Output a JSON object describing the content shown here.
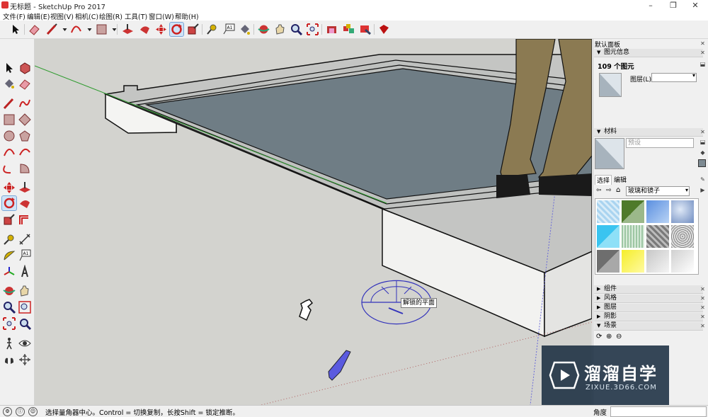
{
  "window": {
    "title": "无标题 - SketchUp Pro 2017",
    "minimize": "–",
    "maximize": "❐",
    "close": "✕"
  },
  "menu": [
    "文件(F)",
    "编辑(E)",
    "视图(V)",
    "相机(C)",
    "绘图(R)",
    "工具(T)",
    "窗口(W)",
    "帮助(H)"
  ],
  "toolbar": {
    "active_tool": "rotate-tool"
  },
  "viewport": {
    "tooltip": "解锁的平面",
    "colors": {
      "ground": "#d3d3cf",
      "glass": "#6f7d85",
      "slab_top": "#c4c5c3",
      "axis_green": "#2e9b2e",
      "protractor": "#3333bb"
    }
  },
  "tray": {
    "header": "默认面板",
    "entity_info": {
      "title": "图元信息",
      "count_label": "109 个图元",
      "layer_label": "图层(L):"
    },
    "materials": {
      "title": "材料",
      "name_placeholder": "预设",
      "tabs": [
        "选择",
        "编辑"
      ],
      "library": "玻璃和镜子"
    },
    "collapsed": [
      "组件",
      "风格",
      "图层",
      "阴影",
      "场景"
    ]
  },
  "status": {
    "message": "选择量角器中心。Control = 切换复制，长按Shift = 锁定推断。",
    "measure_label": "角度"
  },
  "watermark": {
    "brand": "溜溜自学",
    "url": "ZIXUE.3D66.COM"
  }
}
